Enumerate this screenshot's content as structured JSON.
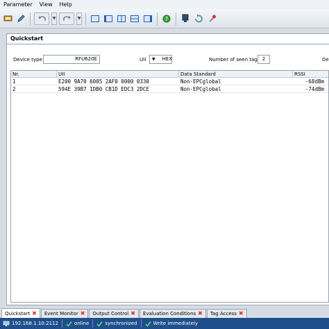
{
  "menu": {
    "items": [
      "Parameter",
      "View",
      "Help"
    ]
  },
  "panel": {
    "title": "Quickstart"
  },
  "form": {
    "device_type_label": "Device type",
    "device_type_value": "RFU620E",
    "uii_label": "UII",
    "uii_value": "HEX",
    "seen_tags_label": "Number of seen tags",
    "seen_tags_value": "2",
    "right_label": "De"
  },
  "table": {
    "headers": [
      "Nr.",
      "UII",
      "Data Standard",
      "RSSI"
    ],
    "rows": [
      [
        "1",
        "E200 9A70 6005 2AF0 0000 0330",
        "Non-EPCglobal",
        "-68dBm"
      ],
      [
        "2",
        "594E 39B7 1DB0 CB1D EDC3 2DCE",
        "Non-EPCglobal",
        "-74dBm"
      ]
    ]
  },
  "tabs": [
    "Quickstart",
    "Event Monitor",
    "Output Control",
    "Evaluation Conditions",
    "Tag Access"
  ],
  "status": {
    "ip": "192.168.1.10:2112",
    "online": "online",
    "sync": "synchronized",
    "write": "Write immediately"
  },
  "colors": {
    "status_bar": "#1f4e8c",
    "close": "#d9332b",
    "accent": "#1f5fb8"
  }
}
